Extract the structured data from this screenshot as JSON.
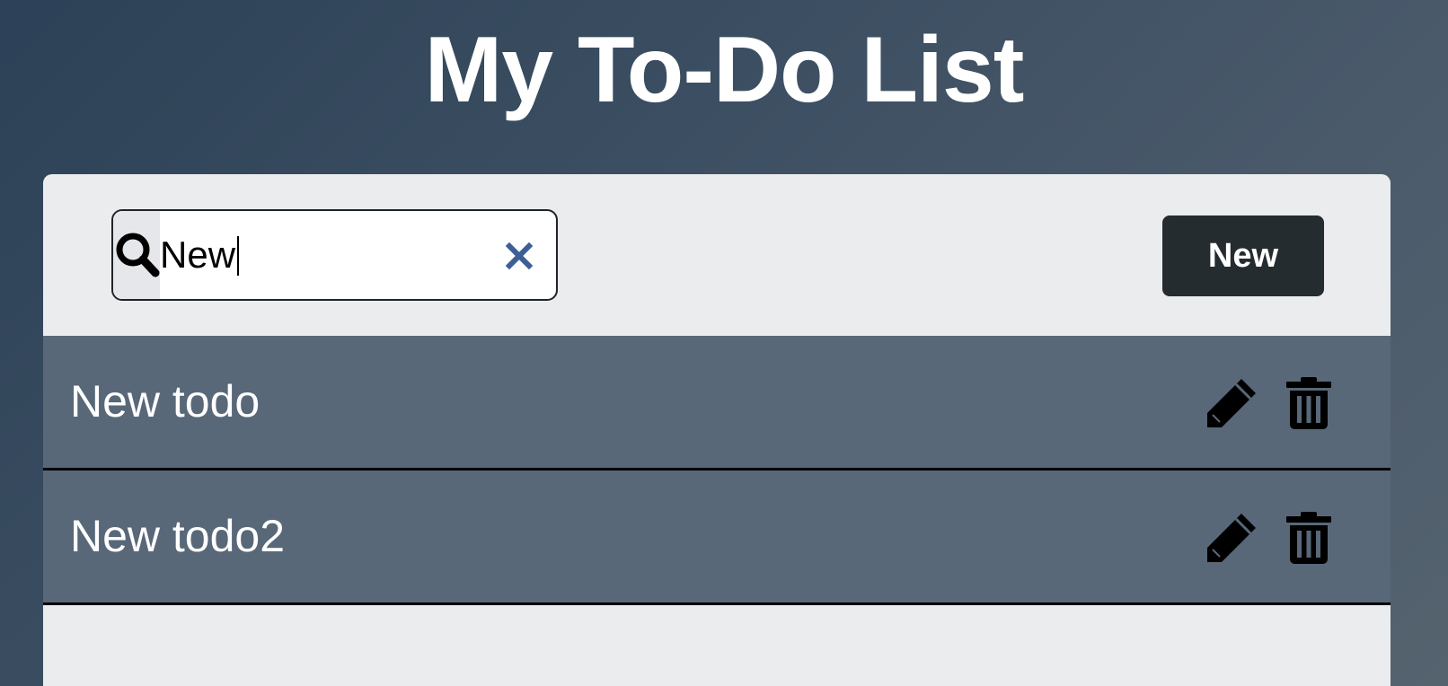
{
  "page": {
    "title": "My To-Do List"
  },
  "toolbar": {
    "search": {
      "value": "New",
      "placeholder": ""
    },
    "new_button_label": "New"
  },
  "todos": [
    {
      "text": "New todo"
    },
    {
      "text": "New todo2"
    }
  ],
  "icons": {
    "search": "search-icon",
    "clear": "close-icon",
    "edit": "pencil-icon",
    "delete": "trash-icon"
  },
  "colors": {
    "panel_bg": "#ebecee",
    "row_bg": "#586879",
    "button_bg": "#252c30",
    "clear_icon": "#3d5f96"
  }
}
